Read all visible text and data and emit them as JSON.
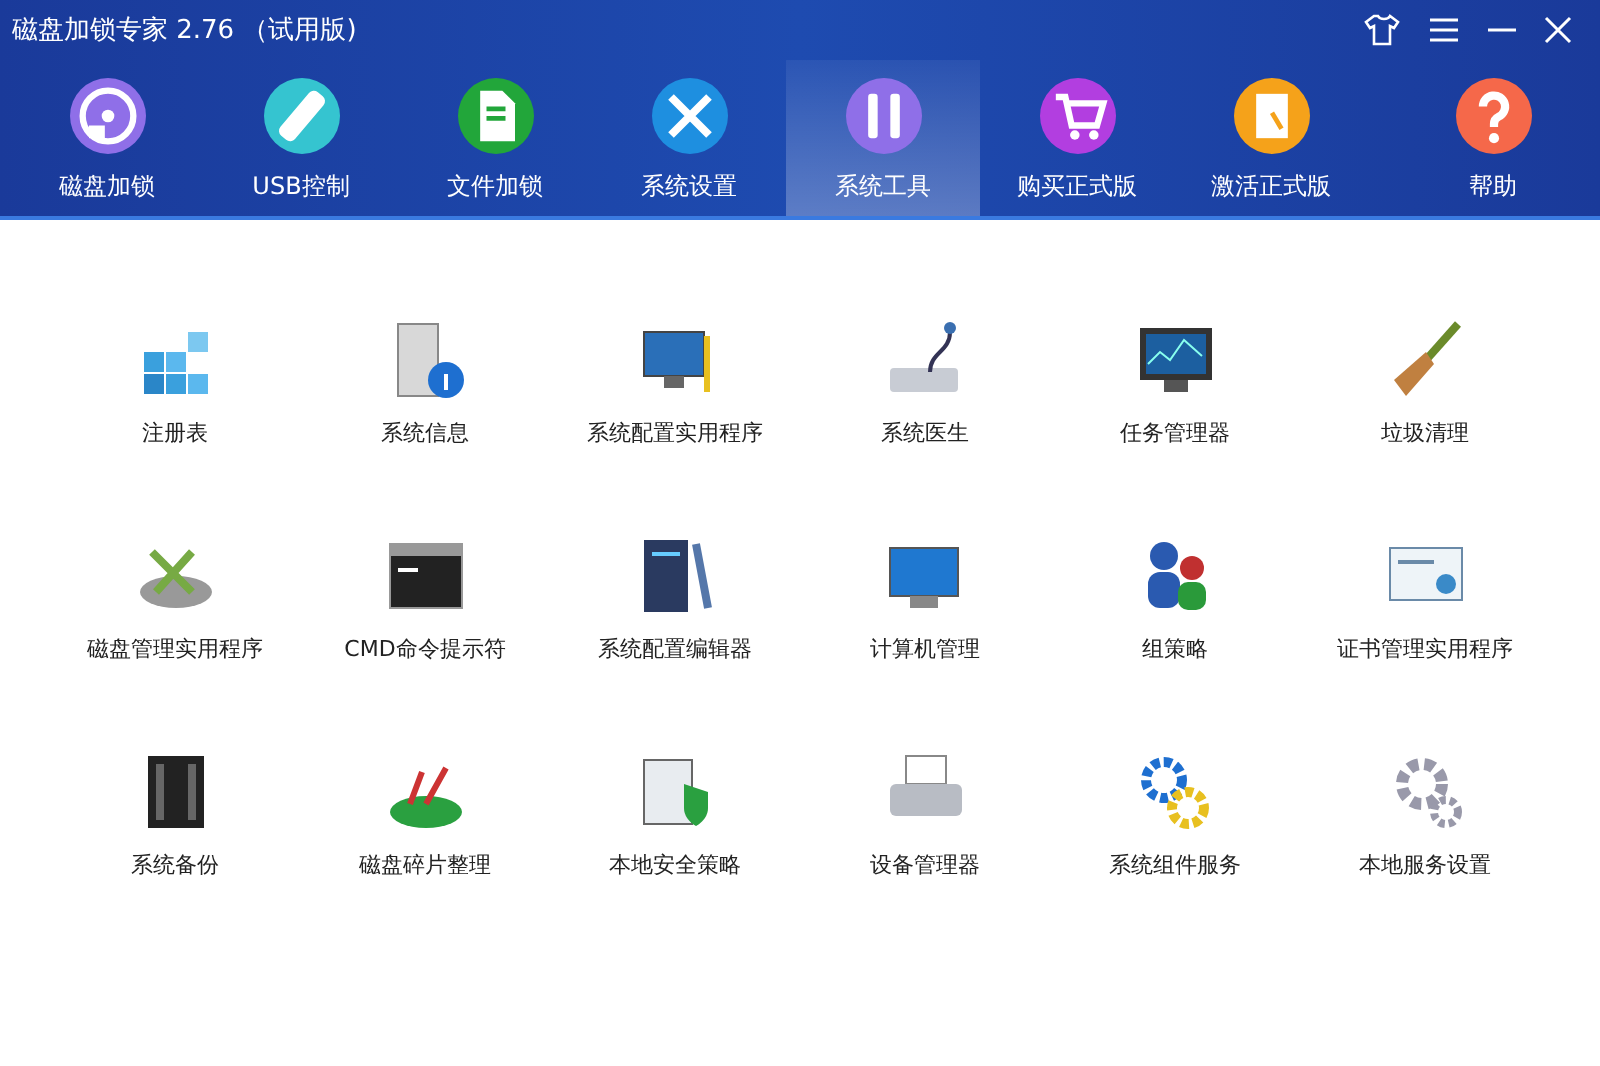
{
  "window": {
    "title": "磁盘加锁专家 2.76 （试用版)"
  },
  "nav": [
    {
      "label": "磁盘加锁",
      "color": "#8f6fe8",
      "selected": false
    },
    {
      "label": "USB控制",
      "color": "#35c4d0",
      "selected": false
    },
    {
      "label": "文件加锁",
      "color": "#22a63a",
      "selected": false
    },
    {
      "label": "系统设置",
      "color": "#1e8fe0",
      "selected": false
    },
    {
      "label": "系统工具",
      "color": "#8f6fe8",
      "selected": true
    },
    {
      "label": "购买正式版",
      "color": "#b23ee0",
      "selected": false
    },
    {
      "label": "激活正式版",
      "color": "#f5a21a",
      "selected": false
    },
    {
      "label": "帮助",
      "color": "#f5684a",
      "selected": false
    }
  ],
  "tools": [
    {
      "label": "注册表"
    },
    {
      "label": "系统信息"
    },
    {
      "label": "系统配置实用程序"
    },
    {
      "label": "系统医生"
    },
    {
      "label": "任务管理器"
    },
    {
      "label": "垃圾清理"
    },
    {
      "label": "磁盘管理实用程序"
    },
    {
      "label": "CMD命令提示符"
    },
    {
      "label": "系统配置编辑器"
    },
    {
      "label": "计算机管理"
    },
    {
      "label": "组策略"
    },
    {
      "label": "证书管理实用程序"
    },
    {
      "label": "系统备份"
    },
    {
      "label": "磁盘碎片整理"
    },
    {
      "label": "本地安全策略"
    },
    {
      "label": "设备管理器"
    },
    {
      "label": "系统组件服务"
    },
    {
      "label": "本地服务设置"
    }
  ]
}
